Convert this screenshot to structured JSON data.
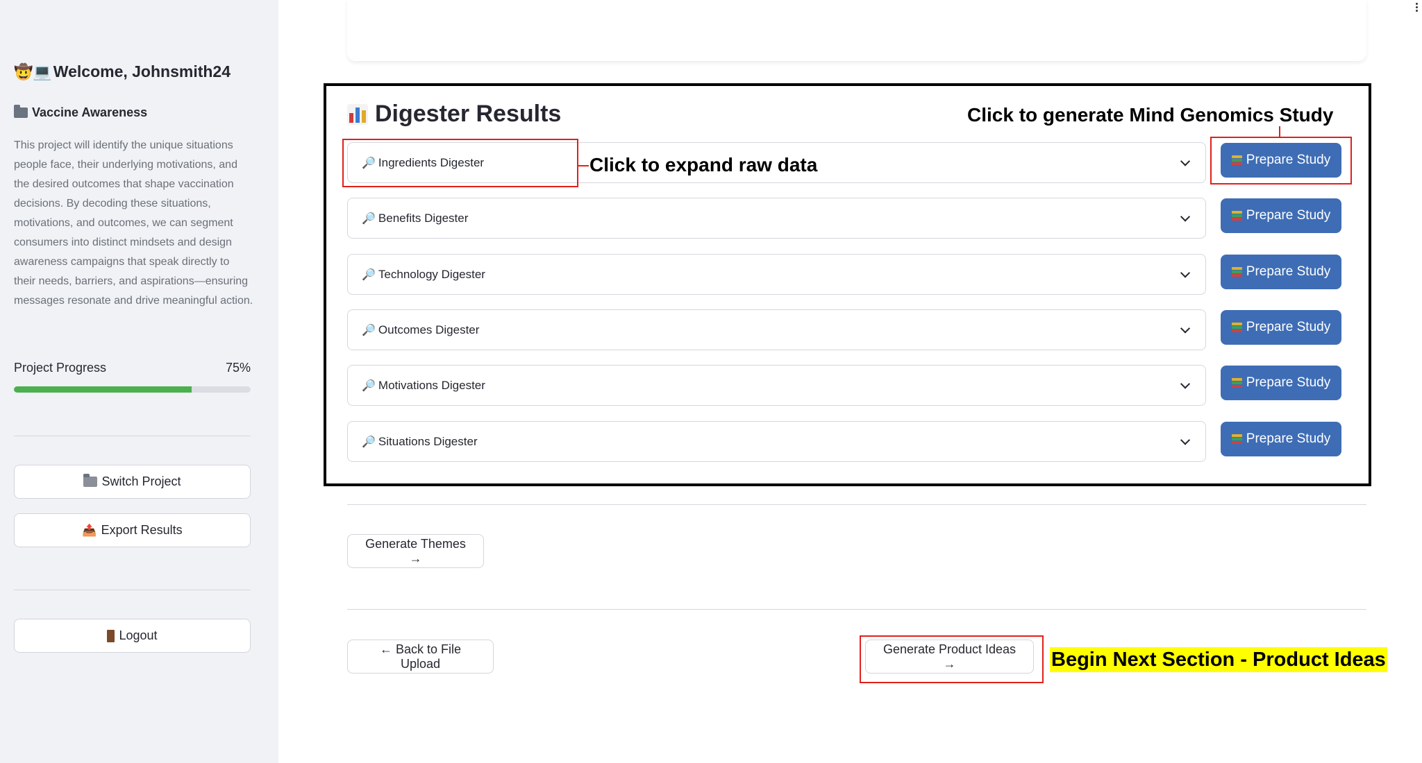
{
  "sidebar": {
    "welcome": "Welcome, Johnsmith24",
    "welcome_emoji": "🤠💻",
    "project_title": "Vaccine Awareness",
    "project_description": "This project will identify the unique situations people face, their underlying motivations, and the desired outcomes that shape vaccination decisions. By decoding these situations, motivations, and outcomes, we can segment consumers into distinct mindsets and design awareness campaigns that speak directly to their needs, barriers, and aspirations—ensuring messages resonate and drive meaningful action.",
    "progress_label": "Project Progress",
    "progress_text": "75%",
    "progress_value": 0.75,
    "buttons": {
      "switch_project": "Switch Project",
      "export_results": "Export Results",
      "logout": "Logout"
    }
  },
  "main": {
    "results_title": "Digester Results",
    "digesters": [
      {
        "label": "Ingredients Digester",
        "button": "Prepare Study"
      },
      {
        "label": "Benefits Digester",
        "button": "Prepare Study"
      },
      {
        "label": "Technology Digester",
        "button": "Prepare Study"
      },
      {
        "label": "Outcomes Digester",
        "button": "Prepare Study"
      },
      {
        "label": "Motivations Digester",
        "button": "Prepare Study"
      },
      {
        "label": "Situations Digester",
        "button": "Prepare Study"
      }
    ],
    "generate_themes": "Generate Themes →",
    "back_button": "← Back to File Upload",
    "generate_product_ideas": "Generate Product Ideas →"
  },
  "annotations": {
    "mind_genomics": "Click to generate Mind Genomics Study",
    "expand_raw": "Click to expand raw data",
    "next_section": "Begin Next Section - Product Ideas"
  },
  "colors": {
    "primary_button": "#3e6db5",
    "progress_fill": "#4caf50",
    "annotation_red": "#e0201b",
    "highlight_yellow": "#ffff00"
  }
}
